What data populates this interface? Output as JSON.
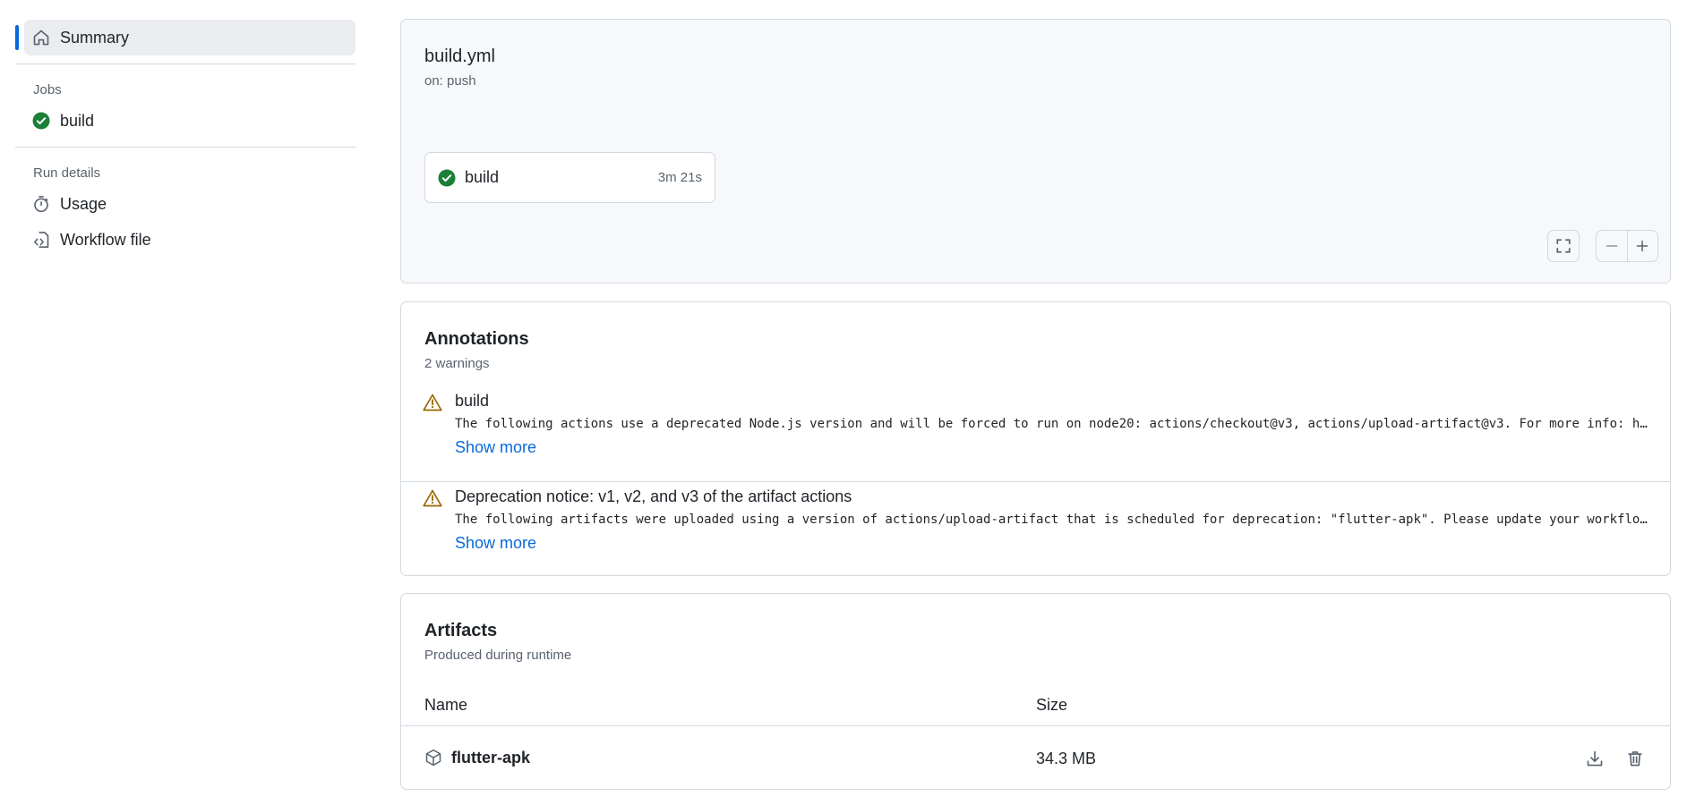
{
  "sidebar": {
    "summary_label": "Summary",
    "jobs_heading": "Jobs",
    "jobs": [
      {
        "label": "build",
        "status": "success"
      }
    ],
    "run_details_heading": "Run details",
    "run_details": [
      {
        "label": "Usage",
        "icon": "stopwatch-icon"
      },
      {
        "label": "Workflow file",
        "icon": "file-code-icon"
      }
    ]
  },
  "workflow": {
    "title": "build.yml",
    "trigger": "on: push",
    "job": {
      "name": "build",
      "duration": "3m 21s",
      "status": "success"
    }
  },
  "annotations": {
    "title": "Annotations",
    "count_label": "2 warnings",
    "items": [
      {
        "title": "build",
        "message": "The following actions use a deprecated Node.js version and will be forced to run on node20: actions/checkout@v3, actions/upload-artifact@v3. For more info: https…",
        "more": "Show more"
      },
      {
        "title": "Deprecation notice: v1, v2, and v3 of the artifact actions",
        "message": "The following artifacts were uploaded using a version of actions/upload-artifact that is scheduled for deprecation: \"flutter-apk\". Please update your workflow to…",
        "more": "Show more"
      }
    ]
  },
  "artifacts": {
    "title": "Artifacts",
    "subtitle": "Produced during runtime",
    "columns": [
      "Name",
      "Size"
    ],
    "rows": [
      {
        "name": "flutter-apk",
        "size": "34.3 MB"
      }
    ]
  },
  "colors": {
    "success": "#1a7f37",
    "warning": "#9a6700",
    "link": "#0969da",
    "selected_indicator": "#0969da"
  }
}
